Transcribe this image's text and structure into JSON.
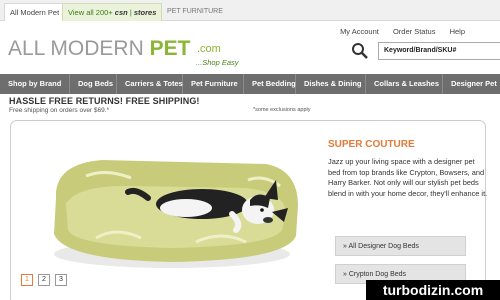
{
  "tabs": {
    "all_modern_pet": "All Modern Pet",
    "csn_prefix": "View all 200+",
    "csn_brand": "csn",
    "csn_stores": "stores",
    "pet_furniture": "PET FURNITURE"
  },
  "header": {
    "logo_all_modern": "ALL MODERN ",
    "logo_pet": "PET",
    "logo_com": ".com",
    "tagline": "...Shop Easy",
    "links": [
      "My Account",
      "Order Status",
      "Help"
    ],
    "search_value": "Keyword/Brand/SKU#"
  },
  "nav": {
    "items": [
      "Shop by Brand",
      "Dog Beds",
      "Carriers & Totes",
      "Pet Furniture",
      "Pet Bedding",
      "Dishes & Dining",
      "Collars & Leashes",
      "Designer Pet"
    ]
  },
  "promo": {
    "headline": "HASSLE FREE RETURNS! FREE SHIPPING!",
    "sub": "Free shipping on orders over $69.*",
    "note": "*some exclusions apply"
  },
  "feature": {
    "title": "SUPER COUTURE",
    "body": "Jazz up your living space with a designer pet bed from top brands like Crypton, Bowsers, and Harry Barker. Not only will our stylish pet beds blend in with your home decor, they'll enhance it.",
    "link1": "» All Designer Dog Beds",
    "link2": "» Crypton Dog Beds",
    "pages": [
      "1",
      "2",
      "3"
    ]
  },
  "watermark": "turbodizin.com",
  "colors": {
    "brand_green": "#8bb534",
    "accent_orange": "#e07b39",
    "nav_gray": "#6e6e6e"
  }
}
